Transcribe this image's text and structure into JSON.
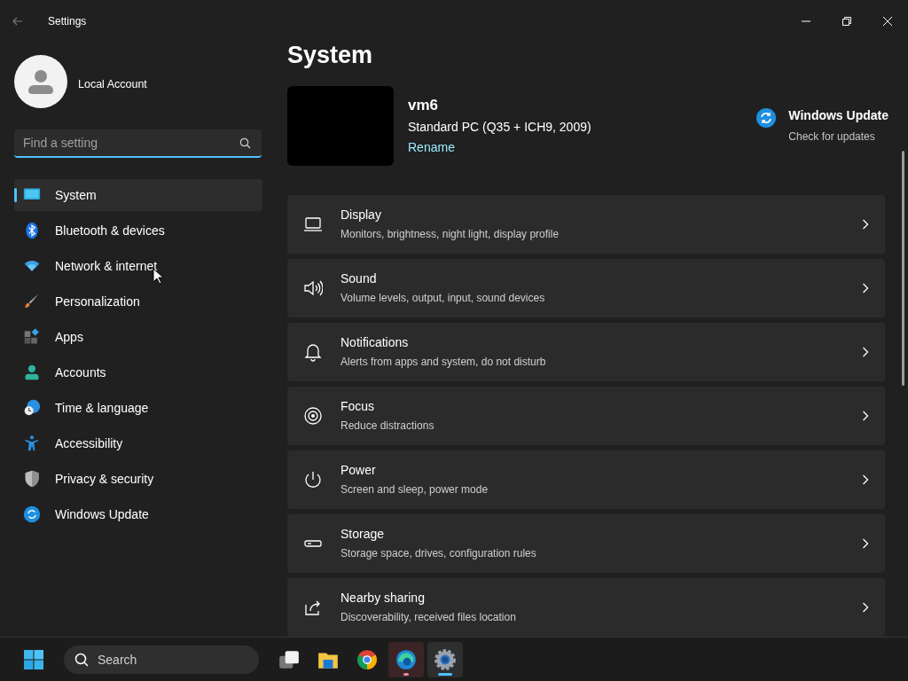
{
  "window": {
    "title": "Settings"
  },
  "account": {
    "name": "Local Account"
  },
  "search": {
    "placeholder": "Find a setting"
  },
  "nav": [
    {
      "kind": "system",
      "label": "System",
      "selected": true
    },
    {
      "kind": "bluetooth",
      "label": "Bluetooth & devices",
      "selected": false
    },
    {
      "kind": "network",
      "label": "Network & internet",
      "selected": false
    },
    {
      "kind": "personalization",
      "label": "Personalization",
      "selected": false
    },
    {
      "kind": "apps",
      "label": "Apps",
      "selected": false
    },
    {
      "kind": "accounts",
      "label": "Accounts",
      "selected": false
    },
    {
      "kind": "time",
      "label": "Time & language",
      "selected": false
    },
    {
      "kind": "accessibility",
      "label": "Accessibility",
      "selected": false
    },
    {
      "kind": "privacy",
      "label": "Privacy & security",
      "selected": false
    },
    {
      "kind": "update",
      "label": "Windows Update",
      "selected": false
    }
  ],
  "page": {
    "title": "System"
  },
  "device": {
    "name": "vm6",
    "model": "Standard PC (Q35 + ICH9, 2009)",
    "rename": "Rename"
  },
  "update": {
    "title": "Windows Update",
    "subtitle": "Check for updates"
  },
  "settings": [
    {
      "kind": "display",
      "title": "Display",
      "subtitle": "Monitors, brightness, night light, display profile"
    },
    {
      "kind": "sound",
      "title": "Sound",
      "subtitle": "Volume levels, output, input, sound devices"
    },
    {
      "kind": "notifications",
      "title": "Notifications",
      "subtitle": "Alerts from apps and system, do not disturb"
    },
    {
      "kind": "focus",
      "title": "Focus",
      "subtitle": "Reduce distractions"
    },
    {
      "kind": "power",
      "title": "Power",
      "subtitle": "Screen and sleep, power mode"
    },
    {
      "kind": "storage",
      "title": "Storage",
      "subtitle": "Storage space, drives, configuration rules"
    },
    {
      "kind": "sharing",
      "title": "Nearby sharing",
      "subtitle": "Discoverability, received files location"
    }
  ],
  "taskbar": {
    "search": {
      "placeholder": "Search"
    },
    "apps": [
      {
        "kind": "taskview",
        "attention": false,
        "active": false
      },
      {
        "kind": "explorer",
        "attention": false,
        "active": false
      },
      {
        "kind": "chrome",
        "attention": false,
        "active": false
      },
      {
        "kind": "edge",
        "attention": true,
        "active": false
      },
      {
        "kind": "settings",
        "attention": false,
        "active": true
      }
    ]
  }
}
